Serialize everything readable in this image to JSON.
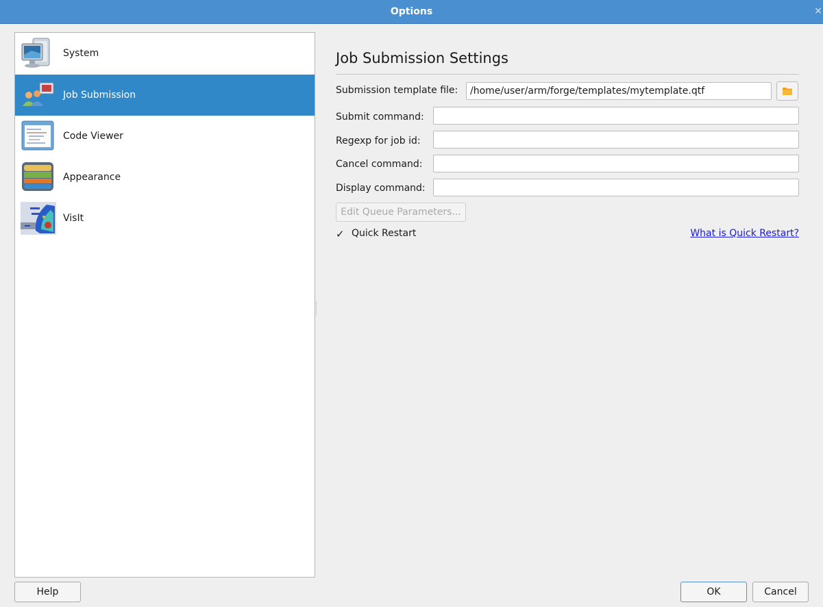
{
  "window": {
    "title": "Options",
    "close_glyph": "×"
  },
  "sidebar": {
    "items": [
      {
        "label": "System",
        "icon": "system-monitor-icon",
        "selected": false
      },
      {
        "label": "Job Submission",
        "icon": "job-submission-icon",
        "selected": true
      },
      {
        "label": "Code Viewer",
        "icon": "code-viewer-icon",
        "selected": false
      },
      {
        "label": "Appearance",
        "icon": "appearance-icon",
        "selected": false
      },
      {
        "label": "VisIt",
        "icon": "visit-icon",
        "selected": false
      }
    ]
  },
  "main": {
    "heading": "Job Submission Settings",
    "fields": {
      "template": {
        "label": "Submission template file:",
        "value": "/home/user/arm/forge/templates/mytemplate.qtf"
      },
      "submit": {
        "label": "Submit command:",
        "value": ""
      },
      "regexp": {
        "label": "Regexp for job id:",
        "value": ""
      },
      "cancel": {
        "label": "Cancel command:",
        "value": ""
      },
      "display": {
        "label": "Display command:",
        "value": ""
      }
    },
    "edit_queue_label": "Edit Queue Parameters...",
    "quick_restart": {
      "label": "Quick Restart",
      "checked": true,
      "check_glyph": "✓"
    },
    "help_link": "What is Quick Restart?"
  },
  "footer": {
    "help_label": "Help",
    "ok_label": "OK",
    "cancel_label": "Cancel"
  },
  "colors": {
    "titlebar": "#4a8fd0",
    "selection": "#3088c8",
    "link": "#1a1adc",
    "background": "#efefef"
  }
}
